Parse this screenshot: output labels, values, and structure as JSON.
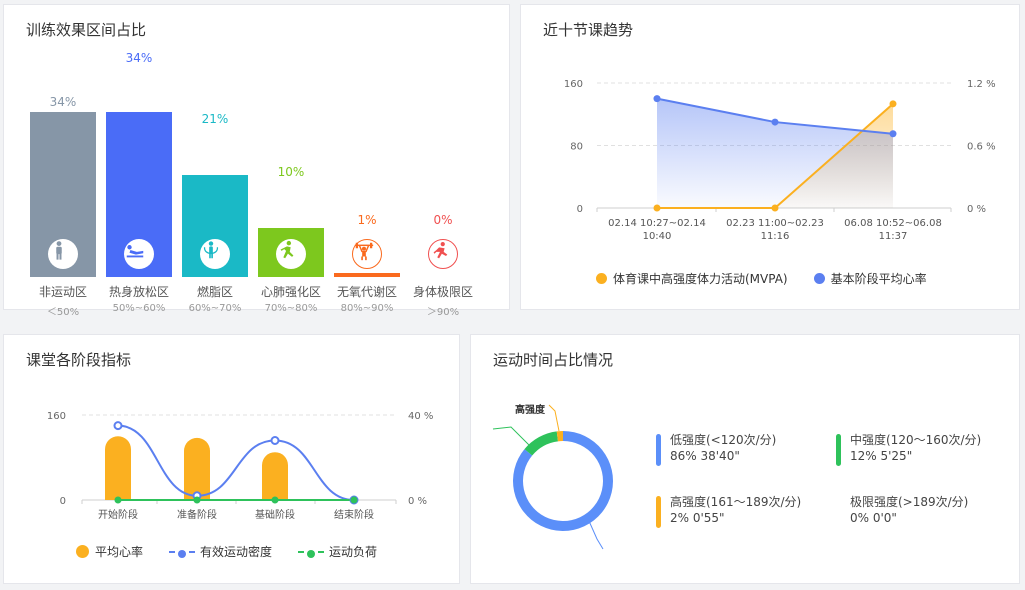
{
  "panels": {
    "zones_title": "训练效果区间占比",
    "trend_title": "近十节课趋势",
    "phase_title": "课堂各阶段指标",
    "time_title": "运动时间占比情况"
  },
  "chart_data": [
    {
      "type": "bar",
      "categories": [
        "非运动区",
        "热身放松区",
        "燃脂区",
        "心肺强化区",
        "无氧代谢区",
        "身体极限区"
      ],
      "ranges": [
        "＜50%",
        "50%~60%",
        "60%~70%",
        "70%~80%",
        "80%~90%",
        "＞90%"
      ],
      "values": [
        34,
        34,
        21,
        10,
        1,
        0
      ],
      "value_labels": [
        "34%",
        "34%",
        "21%",
        "10%",
        "1%",
        "0%"
      ],
      "colors": [
        "#8696a7",
        "#4a6cf7",
        "#1ab9c6",
        "#7dc81e",
        "#fa6a1e",
        "#f05050"
      ],
      "icons": [
        "standing-person-icon",
        "stretching-person-icon",
        "jump-rope-icon",
        "running-person-icon",
        "weightlifting-icon",
        "sprinting-person-icon"
      ],
      "ylim": [
        0,
        100
      ]
    },
    {
      "type": "line",
      "categories": [
        "02.14 10:27~02.14 10:40",
        "02.23 11:00~02.23 11:16",
        "06.08 10:52~06.08 11:37"
      ],
      "category_lines": [
        [
          "02.14 10:27~02.14",
          "10:40"
        ],
        [
          "02.23 11:00~02.23",
          "11:16"
        ],
        [
          "06.08 10:52~06.08",
          "11:37"
        ]
      ],
      "left_axis": {
        "ticks": [
          0,
          80,
          160
        ],
        "labels": [
          "0",
          "80",
          "160"
        ],
        "range": [
          0,
          160
        ]
      },
      "right_axis": {
        "ticks": [
          0,
          0.6,
          1.2
        ],
        "labels": [
          "0 %",
          "0.6 %",
          "1.2 %"
        ],
        "range": [
          0,
          1.2
        ]
      },
      "series": [
        {
          "name": "体育课中高强度体力活动(MVPA)",
          "axis": "right",
          "color": "#fbb020",
          "values": [
            0,
            0,
            1.0
          ]
        },
        {
          "name": "基本阶段平均心率",
          "axis": "left",
          "color": "#5b7ff0",
          "values": [
            140,
            110,
            95
          ]
        }
      ]
    },
    {
      "type": "bar",
      "categories": [
        "开始阶段",
        "准备阶段",
        "基础阶段",
        "结束阶段"
      ],
      "left_axis": {
        "ticks": [
          0,
          160
        ],
        "labels": [
          "0",
          "160"
        ],
        "range": [
          0,
          160
        ]
      },
      "right_axis": {
        "ticks": [
          0,
          40
        ],
        "labels": [
          "0 %",
          "40 %"
        ],
        "range": [
          0,
          40
        ]
      },
      "series": [
        {
          "name": "平均心率",
          "kind": "bar",
          "axis": "left",
          "color": "#fbb020",
          "values": [
            120,
            117,
            90,
            0
          ]
        },
        {
          "name": "有效运动密度",
          "kind": "line",
          "axis": "right",
          "color": "#5b7ff0",
          "values": [
            35,
            2,
            28,
            0
          ]
        },
        {
          "name": "运动负荷",
          "kind": "line",
          "axis": "right",
          "color": "#2ec25b",
          "values": [
            0,
            0,
            0,
            0
          ]
        }
      ]
    },
    {
      "type": "pie",
      "callout": "高强度",
      "slices": [
        {
          "name": "低强度(<120次/分)",
          "percent": 86,
          "percent_label": "86%",
          "time": "38'40\"",
          "color": "#5b8ff9"
        },
        {
          "name": "中强度(120～160次/分)",
          "percent": 12,
          "percent_label": "12%",
          "time": "5'25\"",
          "color": "#2ec25b"
        },
        {
          "name": "高强度(161～189次/分)",
          "percent": 2,
          "percent_label": "2%",
          "time": "0'55\"",
          "color": "#fbb020"
        },
        {
          "name": "极限强度(>189次/分)",
          "percent": 0,
          "percent_label": "0%",
          "time": "0'0\"",
          "color": "#f05050"
        }
      ]
    }
  ]
}
